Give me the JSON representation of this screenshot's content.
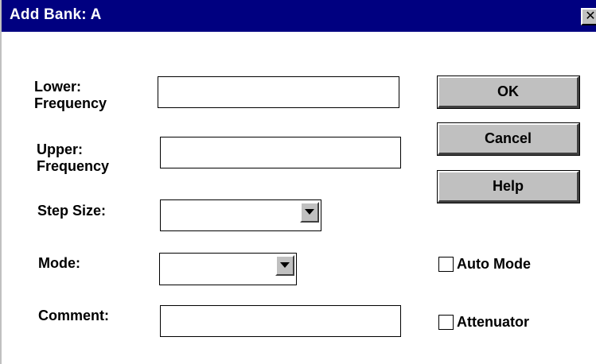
{
  "window": {
    "title": "Add Bank: A",
    "close_glyph": "✕"
  },
  "fields": {
    "lower_frequency": {
      "label_line1": "Lower:",
      "label_line2": "Frequency",
      "value": ""
    },
    "upper_frequency": {
      "label_line1": "Upper:",
      "label_line2": "Frequency",
      "value": ""
    },
    "step_size": {
      "label": "Step Size:",
      "value": ""
    },
    "mode": {
      "label": "Mode:",
      "value": ""
    },
    "comment": {
      "label": "Comment:",
      "value": ""
    }
  },
  "buttons": {
    "ok": "OK",
    "cancel": "Cancel",
    "help": "Help"
  },
  "checkboxes": {
    "auto_mode": {
      "label": "Auto Mode",
      "checked": false
    },
    "attenuator": {
      "label": "Attenuator",
      "checked": false
    }
  },
  "colors": {
    "titlebar": "#000080",
    "button_face": "#c0c0c0"
  },
  "icons": {
    "close": "close-icon",
    "dropdown": "chevron-down-icon"
  }
}
